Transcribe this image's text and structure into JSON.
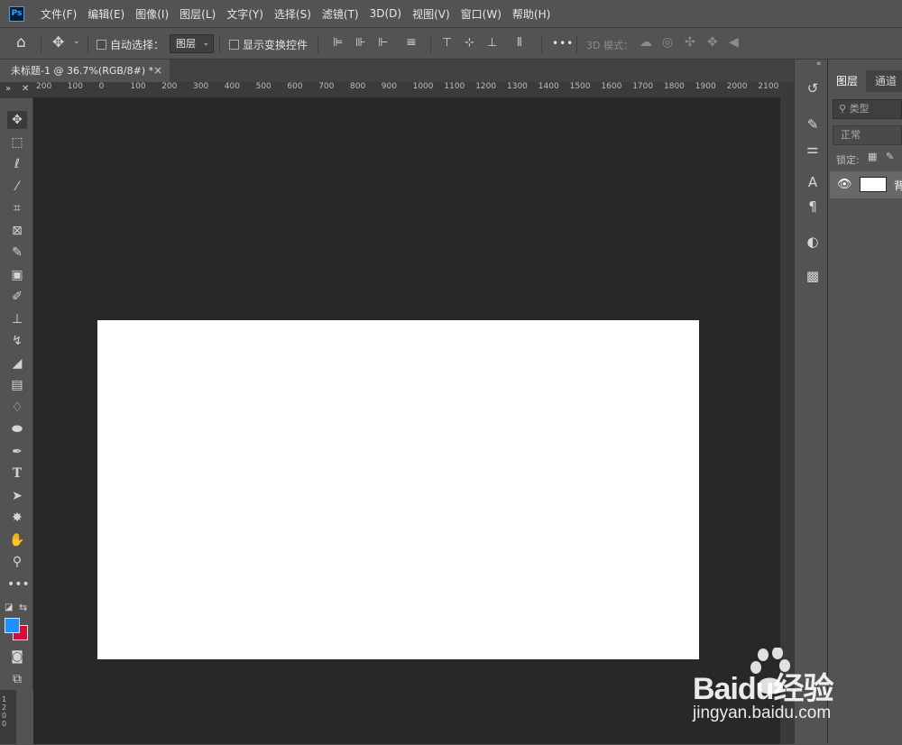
{
  "app": {
    "logo_text": "Ps"
  },
  "menu": [
    "文件(F)",
    "编辑(E)",
    "图像(I)",
    "图层(L)",
    "文字(Y)",
    "选择(S)",
    "滤镜(T)",
    "3D(D)",
    "视图(V)",
    "窗口(W)",
    "帮助(H)"
  ],
  "options_bar": {
    "auto_select_label": "自动选择：",
    "auto_select_target": "图层",
    "show_transform_label": "显示变换控件",
    "more_label": "•••",
    "mode_3d_label": "3D 模式："
  },
  "document_tab": {
    "title": "未标题-1 @ 36.7%(RGB/8#) *",
    "close": "×"
  },
  "ruler": {
    "corner_label": "»",
    "h_labels": [
      "200",
      "100",
      "0",
      "100",
      "200",
      "300",
      "400",
      "500",
      "600",
      "700",
      "800",
      "900",
      "1000",
      "1100",
      "1200",
      "1300",
      "1400",
      "1500",
      "1600",
      "1700",
      "1800",
      "1900",
      "2000",
      "2100"
    ],
    "v_label": "1200"
  },
  "tools": [
    "move-tool",
    "marquee-tool",
    "lasso-tool",
    "magic-wand-tool",
    "crop-tool",
    "frame-tool",
    "eyedropper-tool",
    "healing-brush-tool",
    "brush-tool",
    "clone-stamp-tool",
    "history-brush-tool",
    "eraser-tool",
    "gradient-tool",
    "blur-tool",
    "dodge-tool",
    "pen-tool",
    "type-tool",
    "path-selection-tool",
    "custom-shape-tool",
    "hand-tool",
    "zoom-tool",
    "more-tools"
  ],
  "colors": {
    "foreground": "#1e90ff",
    "background": "#d0103a",
    "canvas": "#ffffff",
    "pasteboard": "#282828"
  },
  "panel": {
    "tabs": [
      "图层",
      "通道"
    ],
    "filter_placeholder": "类型",
    "blend_mode": "正常",
    "lock_label": "锁定:",
    "layer_name_partial": "背"
  },
  "watermark": {
    "brand": "Baidu经验",
    "url": "jingyan.baidu.com"
  }
}
